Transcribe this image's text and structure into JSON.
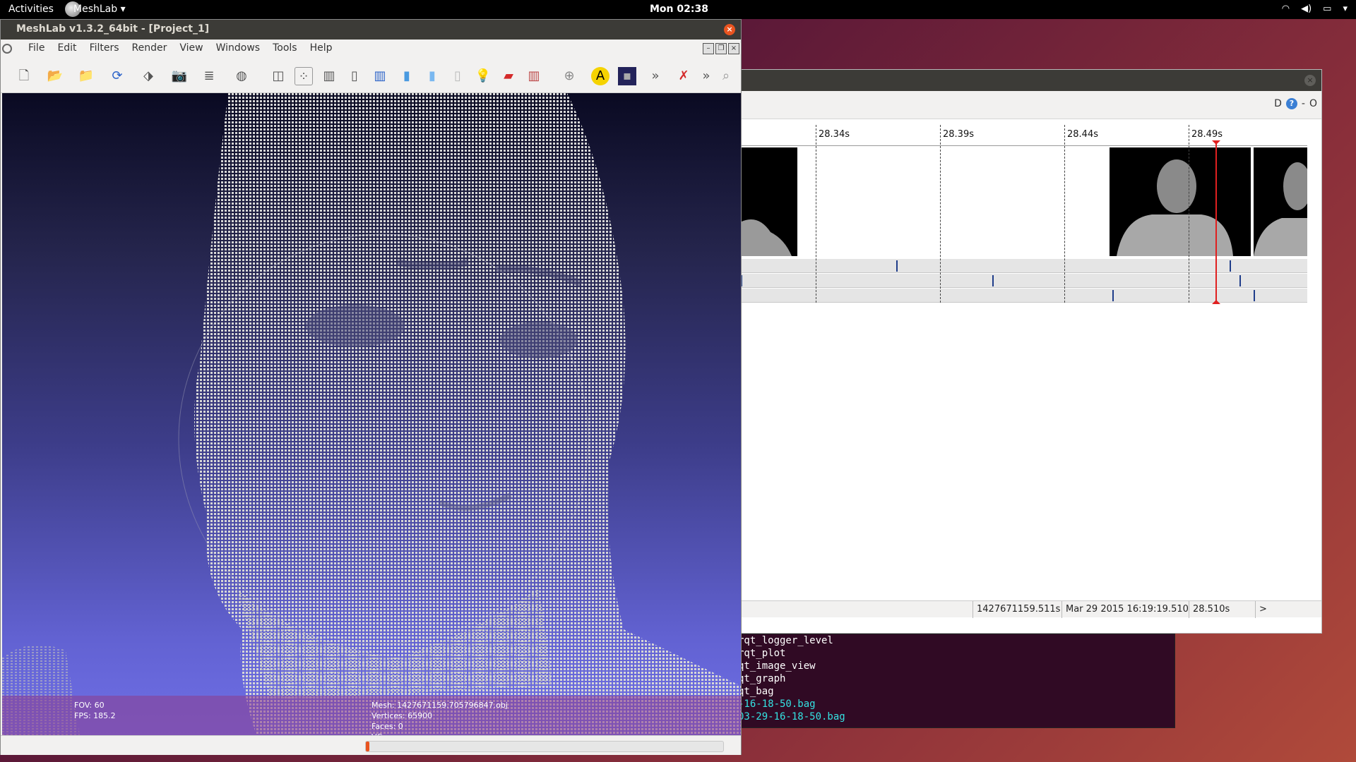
{
  "top_panel": {
    "activities": "Activities",
    "app_name": "MeshLab",
    "clock": "Mon 02:38"
  },
  "meshlab": {
    "title": "MeshLab v1.3.2_64bit - [Project_1]",
    "menu": [
      "File",
      "Edit",
      "Filters",
      "Render",
      "View",
      "Windows",
      "Tools",
      "Help"
    ],
    "toolbar_icons": [
      "new-file-icon",
      "open-project-icon",
      "open-file-icon",
      "reload-icon",
      "save-icon",
      "snapshot-icon",
      "layers-icon",
      "sphere-icon",
      "bbox-icon",
      "points-icon",
      "wireframe-icon",
      "hidden-lines-icon",
      "flat-lines-icon",
      "flat-icon",
      "smooth-icon",
      "texture-icon",
      "light-icon",
      "color-icon",
      "more-render-icon",
      "axis-icon",
      "text-icon",
      "decorate-icon",
      "overflow-icon",
      "delete-icon",
      "overflow-icon-2",
      "zoom-icon"
    ],
    "info": {
      "fov": "FOV: 60",
      "fps": "FPS:   185.2",
      "mesh": "Mesh: 1427671159.705796847.obj",
      "vertices": "Vertices: 65900",
      "faces": "Faces: 0",
      "vc": "VC"
    },
    "progress": 0.01,
    "accent_color": "#e95420"
  },
  "rqt_bag": {
    "ticks": [
      "28.34s",
      "28.39s",
      "28.44s",
      "28.49s"
    ],
    "status": {
      "stamp": "1427671159.511s",
      "date": "Mar 29 2015 16:19:19.510",
      "elapsed": "28.510s",
      "next": ">"
    },
    "toolbar_right": [
      "D",
      "?",
      "-",
      "O"
    ]
  },
  "terminal": {
    "lines": [
      "rqt_logger_level",
      "rqt_plot",
      "qt_image_view",
      "qt_graph",
      "qt_bag",
      "-16-18-50.bag",
      "03-29-16-18-50.bag"
    ]
  }
}
